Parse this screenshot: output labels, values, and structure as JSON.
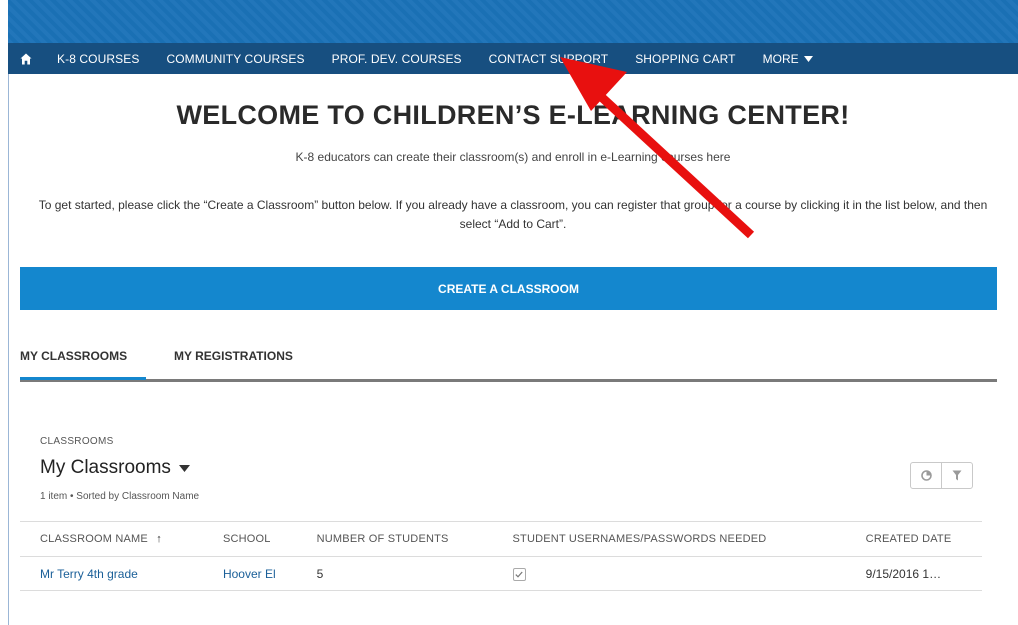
{
  "nav": {
    "items": [
      "K-8 COURSES",
      "COMMUNITY COURSES",
      "PROF. DEV. COURSES",
      "CONTACT SUPPORT",
      "SHOPPING CART"
    ],
    "more_label": "MORE",
    "home_icon": "home-icon"
  },
  "welcome": {
    "title": "WELCOME TO CHILDREN’S E-LEARNING CENTER!",
    "subtitle": "K-8 educators can create their classroom(s) and enroll in e-Learning courses here",
    "instructions": "To get started, please click the “Create a Classroom” button below. If you already have a classroom, you can register that group for a course by clicking it in the list below, and then select “Add to Cart”."
  },
  "create_button_label": "CREATE A CLASSROOM",
  "tabs": [
    "MY CLASSROOMS",
    "MY REGISTRATIONS"
  ],
  "list": {
    "eyebrow": "CLASSROOMS",
    "title": "My Classrooms",
    "meta": "1 item • Sorted by Classroom Name",
    "columns": [
      "CLASSROOM NAME",
      "SCHOOL",
      "NUMBER OF STUDENTS",
      "STUDENT USERNAMES/PASSWORDS NEEDED",
      "CREATED DATE"
    ],
    "sort_indicator": "↑",
    "rows": [
      {
        "name": "Mr Terry 4th grade",
        "school": "Hoover El",
        "students": "5",
        "passwords_needed": true,
        "created": "9/15/2016 1…"
      }
    ]
  },
  "colors": {
    "banner": "#1b72b8",
    "navbar": "#174f80",
    "button": "#1487ce",
    "link": "#1a5f98",
    "annotation_arrow": "#e8100f"
  }
}
